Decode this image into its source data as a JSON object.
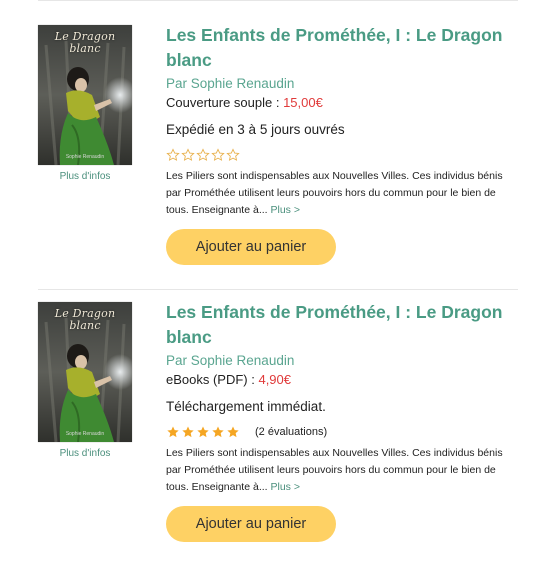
{
  "products": [
    {
      "cover": {
        "title_line1": "Le Dragon",
        "title_line2": "blanc",
        "author": "Sophie Renaudin"
      },
      "more_info": "Plus d'infos",
      "title": "Les Enfants de Prométhée, I : Le Dragon blanc",
      "author": "Par Sophie Renaudin",
      "format": "Couverture souple : ",
      "price": "15,00€",
      "availability": "Expédié en 3 à 5 jours ouvrés",
      "rating": 0,
      "rating_text": "",
      "description": "Les Piliers sont indispensables aux Nouvelles Villes. Ces individus bénis par Prométhée utilisent leurs pouvoirs hors du commun pour le bien de tous. Enseignante à...",
      "more_link": "Plus >",
      "add_to_cart": "Ajouter au panier"
    },
    {
      "cover": {
        "title_line1": "Le Dragon",
        "title_line2": "blanc",
        "author": "Sophie Renaudin"
      },
      "more_info": "Plus d'infos",
      "title": "Les Enfants de Prométhée, I : Le Dragon blanc",
      "author": "Par Sophie Renaudin",
      "format": "eBooks (PDF) : ",
      "price": "4,90€",
      "availability": "Téléchargement immédiat.",
      "rating": 5,
      "rating_text": "(2 évaluations)",
      "description": "Les Piliers sont indispensables aux Nouvelles Villes. Ces individus bénis par Prométhée utilisent leurs pouvoirs hors du commun pour le bien de tous. Enseignante à...",
      "more_link": "Plus >",
      "add_to_cart": "Ajouter au panier"
    }
  ],
  "colors": {
    "title": "#4a9b84",
    "price": "#e03a3a",
    "button": "#fed164",
    "star_filled": "#f5a623",
    "star_empty_outline": "#e8b04a"
  }
}
